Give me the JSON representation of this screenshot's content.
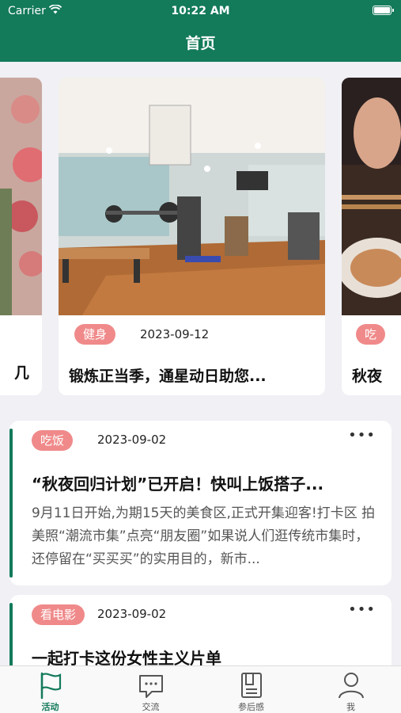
{
  "status_bar": {
    "carrier": "Carrier",
    "time": "10:22 AM"
  },
  "nav": {
    "title": "首页"
  },
  "carousel": {
    "slides": [
      {
        "tag": "",
        "date": "",
        "title": "几"
      },
      {
        "tag": "健身",
        "date": "2023-09-12",
        "title": "锻炼正当季，通星动日助您..."
      },
      {
        "tag": "吃",
        "date": "",
        "title": "秋夜"
      }
    ]
  },
  "posts": [
    {
      "tag": "吃饭",
      "date": "2023-09-02",
      "more": "•••",
      "title": "“秋夜回归计划”已开启！快叫上饭搭子...",
      "body": "9月11日开始,为期15天的美食区,正式开集迎客!打卡区 拍美照“潮流市集”点亮“朋友圈”如果说人们逛传统市集时，还停留在“买买买”的实用目的，新市..."
    },
    {
      "tag": "看电影",
      "date": "2023-09-02",
      "more": "•••",
      "title": "一起打卡这份女性主义片单",
      "body": ""
    }
  ],
  "tabbar": {
    "tabs": [
      {
        "label": "活动",
        "icon": "flag-icon",
        "active": true
      },
      {
        "label": "交流",
        "icon": "chat-icon",
        "active": false
      },
      {
        "label": "参后感",
        "icon": "notes-icon",
        "active": false
      },
      {
        "label": "我",
        "icon": "person-icon",
        "active": false
      }
    ]
  },
  "colors": {
    "brand": "#137a5a",
    "tag": "#f08a8a",
    "background": "#f0f0f5"
  }
}
